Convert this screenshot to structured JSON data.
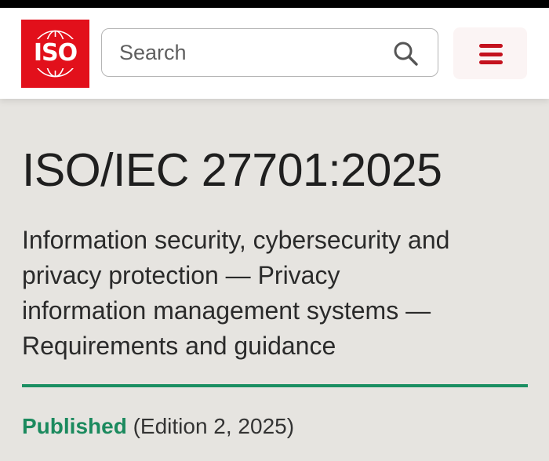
{
  "header": {
    "logo_text": "ISO",
    "search": {
      "placeholder": "Search",
      "value": "",
      "icon": "search-icon"
    },
    "menu_icon": "hamburger-menu-icon"
  },
  "document": {
    "title": "ISO/IEC 27701:2025",
    "subtitle": "Information security, cybersecurity and privacy protection — Privacy information management systems — Requirements and guidance",
    "status": "Published",
    "edition": "(Edition 2, 2025)"
  },
  "colors": {
    "brand_red": "#e2101b",
    "accent_green": "#1b8a5e",
    "background": "#e6e4e0"
  }
}
